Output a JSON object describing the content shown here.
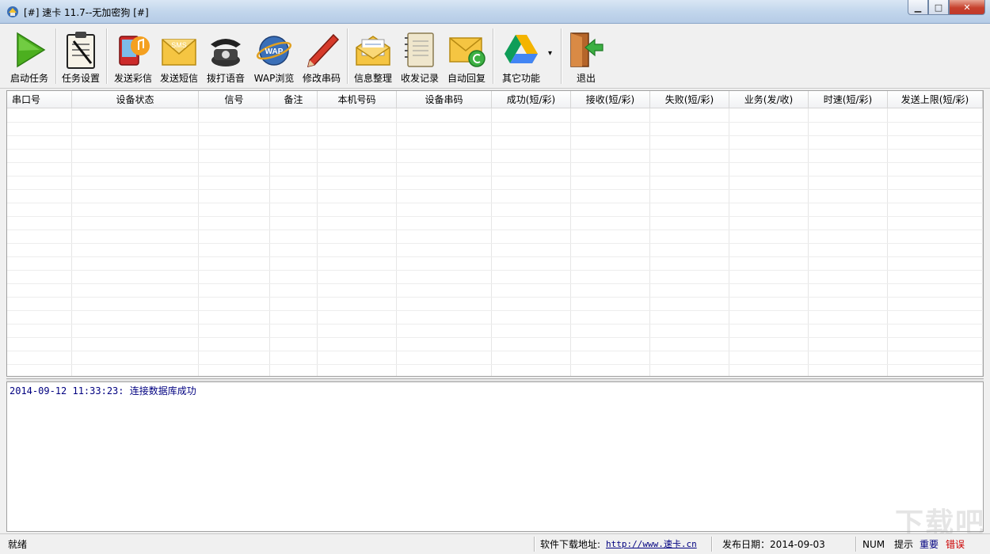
{
  "window": {
    "title": "[#] 速卡 11.7--无加密狗 [#]",
    "min_glyph": "▁",
    "max_glyph": "□",
    "close_glyph": "✕"
  },
  "toolbar": {
    "buttons": [
      {
        "label": "启动任务",
        "icon": "play-icon"
      },
      {
        "label": "任务设置",
        "icon": "clipboard-icon"
      },
      {
        "label": "发送彩信",
        "icon": "mms-phone-icon"
      },
      {
        "label": "发送短信",
        "icon": "sms-envelope-icon"
      },
      {
        "label": "拨打语音",
        "icon": "telephone-icon"
      },
      {
        "label": "WAP浏览",
        "icon": "wap-globe-icon"
      },
      {
        "label": "修改串码",
        "icon": "pencil-icon"
      },
      {
        "label": "信息整理",
        "icon": "open-envelope-icon"
      },
      {
        "label": "收发记录",
        "icon": "notebook-icon"
      },
      {
        "label": "自动回复",
        "icon": "reply-envelope-icon"
      },
      {
        "label": "其它功能",
        "icon": "drive-icon"
      },
      {
        "label": "退出",
        "icon": "exit-door-icon"
      }
    ],
    "dropdown_glyph": "▾"
  },
  "table": {
    "columns": [
      "串口号",
      "设备状态",
      "信号",
      "备注",
      "本机号码",
      "设备串码",
      "成功(短/彩)",
      "接收(短/彩)",
      "失败(短/彩)",
      "业务(发/收)",
      "时速(短/彩)",
      "发送上限(短/彩)"
    ],
    "rows": []
  },
  "log": {
    "lines": [
      "2014-09-12 11:33:23: 连接数据库成功"
    ]
  },
  "statusbar": {
    "status": "就绪",
    "download_label": "软件下载地址:",
    "download_url": "http://www.速卡.cn",
    "release_date": "发布日期：2014-09-03",
    "num": "NUM",
    "hint": "提示",
    "important": "重要",
    "error": "错误"
  },
  "colors": {
    "important": "#000080",
    "error": "#cc0000",
    "log_text": "#000080"
  },
  "watermark": "下载吧"
}
